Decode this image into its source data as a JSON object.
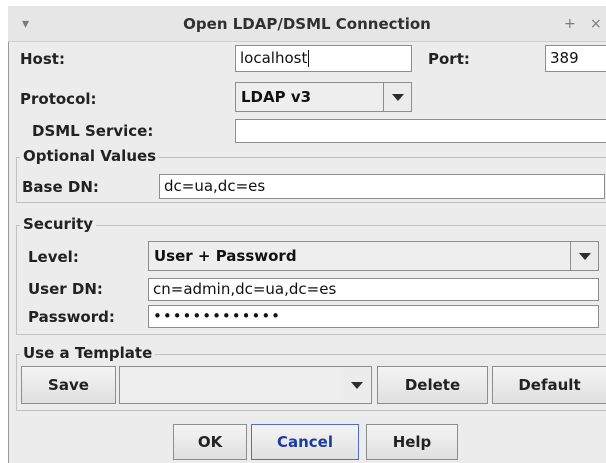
{
  "window": {
    "title": "Open LDAP/DSML Connection",
    "menu_glyph": "▾",
    "maximize_glyph": "+",
    "close_glyph": "×"
  },
  "connection": {
    "host_label": "Host:",
    "host_value": "localhost",
    "port_label": "Port:",
    "port_value": "389",
    "protocol_label": "Protocol:",
    "protocol_value": "LDAP v3",
    "dsml_label": "DSML Service:",
    "dsml_value": ""
  },
  "optional": {
    "legend": "Optional Values",
    "base_dn_label": "Base DN:",
    "base_dn_value": "dc=ua,dc=es"
  },
  "security": {
    "legend": "Security",
    "level_label": "Level:",
    "level_value": "User + Password",
    "user_dn_label": "User DN:",
    "user_dn_value": "cn=admin,dc=ua,dc=es",
    "password_label": "Password:",
    "password_value": "•••••••••••••"
  },
  "template": {
    "legend": "Use a Template",
    "save_label": "Save",
    "selected": "",
    "delete_label": "Delete",
    "default_label": "Default"
  },
  "footer": {
    "ok_label": "OK",
    "cancel_label": "Cancel",
    "help_label": "Help"
  }
}
